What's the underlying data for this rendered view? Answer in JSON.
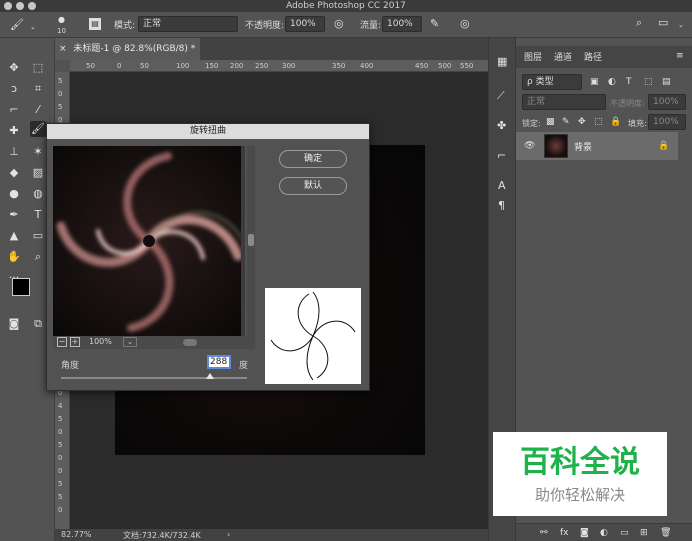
{
  "app": {
    "title": "Adobe Photoshop CC 2017"
  },
  "options": {
    "brush_size": "10",
    "mode_label": "模式:",
    "mode_value": "正常",
    "opacity_label": "不透明度:",
    "opacity_value": "100%",
    "flow_label": "流量:",
    "flow_value": "100%"
  },
  "doc": {
    "tab_close": "×",
    "tab_title": "未标题-1 @ 82.8%(RGB/8) *",
    "zoom": "82.77%",
    "doc_info": "文档:732.4K/732.4K",
    "arrow": "›"
  },
  "ruler": {
    "top": [
      "50",
      "0",
      "50",
      "100",
      "150",
      "200",
      "250",
      "300",
      "350",
      "400",
      "450",
      "500",
      "550"
    ],
    "left": [
      "5",
      "0",
      "5",
      "0",
      "1",
      "0",
      "0",
      "1",
      "5",
      "0",
      "2",
      "0",
      "0",
      "2",
      "5",
      "0",
      "3",
      "0",
      "0",
      "3",
      "5",
      "0",
      "4",
      "0",
      "0",
      "4",
      "5",
      "0",
      "5",
      "0",
      "0",
      "5",
      "5",
      "0"
    ]
  },
  "dialog": {
    "title": "旋转扭曲",
    "ok": "确定",
    "default": "默认",
    "zoom": "100%",
    "angle_label": "角度",
    "angle_value": "288",
    "unit": "度",
    "slider_fraction": 0.8,
    "minus": "−",
    "plus": "+"
  },
  "layers": {
    "tab_layers": "图层",
    "tab_channels": "通道",
    "tab_paths": "路径",
    "kind": "ρ 类型",
    "blend": "正常",
    "opacity_label": "不透明度:",
    "opacity_value": "100%",
    "lock_label": "锁定:",
    "fill_label": "填充:",
    "fill_value": "100%",
    "background_layer": "背景",
    "footer_fx": "fx"
  },
  "watermark": {
    "line1": "百科全说",
    "line2": "助你轻松解决"
  },
  "colors": {
    "accent": "#1fb24a",
    "panel": "#535353",
    "dark": "#2b2b2b"
  }
}
